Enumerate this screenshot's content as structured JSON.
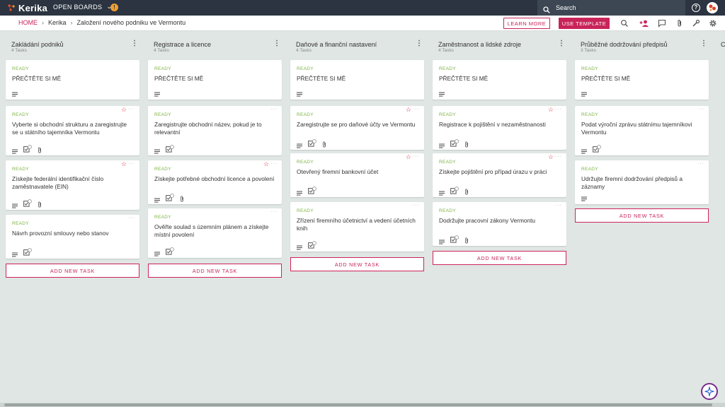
{
  "app": {
    "brand": "Kerika",
    "open_boards_label": "OPEN BOARDS",
    "search_placeholder": "Search",
    "help_label": "?"
  },
  "breadcrumb": {
    "home": "HOME",
    "org": "Kerika",
    "board": "Založení nového podniku ve Vermontu"
  },
  "toolbar": {
    "learn_more": "LEARN MORE",
    "use_template": "USE TEMPLATE",
    "tools": [
      "search-icon",
      "add-person-icon",
      "chat-icon",
      "attachment-icon",
      "wrench-icon",
      "gear-icon"
    ]
  },
  "colors": {
    "accent": "#c8245a",
    "ready": "#7cb342",
    "topbar": "#2b3440",
    "board_bg": "#dfe6e3"
  },
  "add_task_label": "ADD NEW TASK",
  "columns": [
    {
      "title": "Zakládání podniků",
      "count": "4 Tasks",
      "cards": [
        {
          "status": "READY",
          "title": "PŘEČTĚTE SI MĚ",
          "star": false,
          "checklist": false,
          "attach": false
        },
        {
          "status": "READY",
          "title": "Vyberte si obchodní strukturu a zaregistrujte se u státního tajemníka Vermontu",
          "star": true,
          "checklist": true,
          "attach": true
        },
        {
          "status": "READY",
          "title": "Získejte federální identifikační číslo zaměstnavatele (EIN)",
          "star": true,
          "checklist": true,
          "attach": true
        },
        {
          "status": "READY",
          "title": "Návrh provozní smlouvy nebo stanov",
          "star": false,
          "checklist": true,
          "attach": false
        }
      ]
    },
    {
      "title": "Registrace a licence",
      "count": "4 Tasks",
      "cards": [
        {
          "status": "READY",
          "title": "PŘEČTĚTE SI MĚ",
          "star": false,
          "checklist": false,
          "attach": false
        },
        {
          "status": "READY",
          "title": "Zaregistrujte obchodní název, pokud je to relevantní",
          "star": false,
          "checklist": true,
          "attach": false
        },
        {
          "status": "READY",
          "title": "Získejte potřebné obchodní licence a povolení",
          "star": true,
          "checklist": true,
          "attach": true
        },
        {
          "status": "READY",
          "title": "Ověřte soulad s územním plánem a získejte místní povolení",
          "star": false,
          "checklist": true,
          "attach": false
        }
      ]
    },
    {
      "title": "Daňové a finanční nastavení",
      "count": "4 Tasks",
      "cards": [
        {
          "status": "READY",
          "title": "PŘEČTĚTE SI MĚ",
          "star": false,
          "checklist": false,
          "attach": false
        },
        {
          "status": "READY",
          "title": "Zaregistrujte se pro daňové účty ve Vermontu",
          "star": true,
          "checklist": true,
          "attach": true
        },
        {
          "status": "READY",
          "title": "Otevřený firemní bankovní účet",
          "star": true,
          "checklist": true,
          "attach": false
        },
        {
          "status": "READY",
          "title": "Zřízení firemního účetnictví a vedení účetních knih",
          "star": false,
          "checklist": true,
          "attach": false
        }
      ]
    },
    {
      "title": "Zaměstnanost a lidské zdroje",
      "count": "4 Tasks",
      "cards": [
        {
          "status": "READY",
          "title": "PŘEČTĚTE SI MĚ",
          "star": false,
          "checklist": false,
          "attach": false
        },
        {
          "status": "READY",
          "title": "Registrace k pojištění v nezaměstnanosti",
          "star": true,
          "checklist": true,
          "attach": true
        },
        {
          "status": "READY",
          "title": "Získejte pojištění pro případ úrazu v práci",
          "star": true,
          "checklist": true,
          "attach": true
        },
        {
          "status": "READY",
          "title": "Dodržujte pracovní zákony Vermontu",
          "star": false,
          "checklist": true,
          "attach": true
        }
      ]
    },
    {
      "title": "Průběžné dodržování předpisů",
      "count": "3 Tasks",
      "cards": [
        {
          "status": "READY",
          "title": "PŘEČTĚTE SI MĚ",
          "star": false,
          "checklist": false,
          "attach": false
        },
        {
          "status": "READY",
          "title": "Podat výroční zprávu státnímu tajemníkovi Vermontu",
          "star": false,
          "checklist": true,
          "attach": false
        },
        {
          "status": "READY",
          "title": "Udržujte firemní dodržování předpisů a záznamy",
          "star": false,
          "checklist": false,
          "attach": false
        }
      ]
    }
  ]
}
